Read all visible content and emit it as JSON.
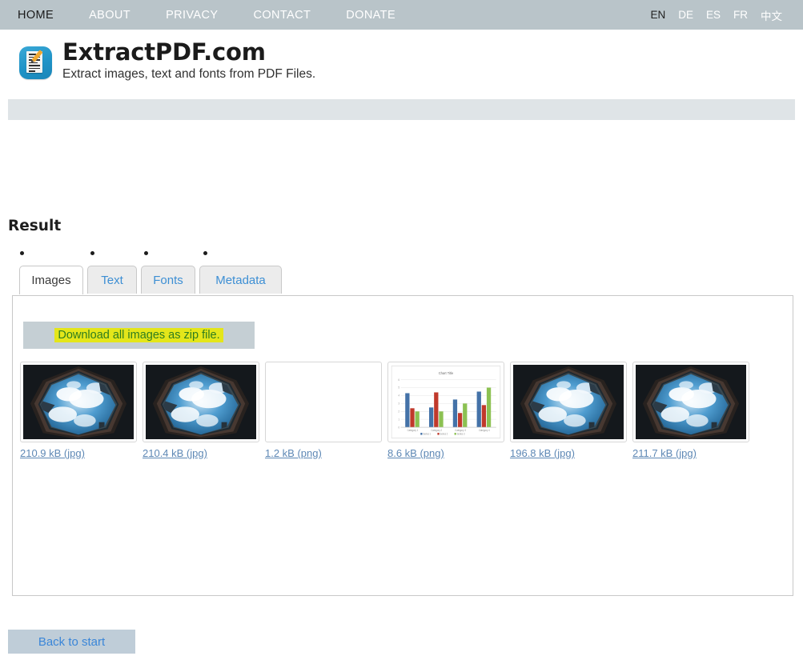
{
  "nav": {
    "items": [
      {
        "label": "HOME",
        "active": true
      },
      {
        "label": "ABOUT",
        "active": false
      },
      {
        "label": "PRIVACY",
        "active": false
      },
      {
        "label": "CONTACT",
        "active": false
      },
      {
        "label": "DONATE",
        "active": false
      }
    ],
    "languages": [
      {
        "label": "EN",
        "active": true
      },
      {
        "label": "DE",
        "active": false
      },
      {
        "label": "ES",
        "active": false
      },
      {
        "label": "FR",
        "active": false
      },
      {
        "label": "中文",
        "active": false
      }
    ]
  },
  "brand": {
    "title": "ExtractPDF.com",
    "tagline": "Extract images, text and fonts from PDF Files.",
    "logo_icon": "document-pencil-icon"
  },
  "result": {
    "heading": "Result"
  },
  "tabs": [
    {
      "label": "Images",
      "active": true
    },
    {
      "label": "Text",
      "active": false
    },
    {
      "label": "Fonts",
      "active": false
    },
    {
      "label": "Metadata",
      "active": false
    }
  ],
  "panel": {
    "download_all_label": "Download all images as zip file.",
    "thumbnails": [
      {
        "label": "210.9 kB (jpg)",
        "kind": "porthole-sky-photo"
      },
      {
        "label": "210.4 kB (jpg)",
        "kind": "porthole-sky-photo"
      },
      {
        "label": "1.2 kB (png)",
        "kind": "blank"
      },
      {
        "label": "8.6 kB (png)",
        "kind": "bar-chart"
      },
      {
        "label": "196.8 kB (jpg)",
        "kind": "porthole-sky-photo"
      },
      {
        "label": "211.7 kB (jpg)",
        "kind": "porthole-sky-photo"
      }
    ]
  },
  "footer": {
    "back_label": "Back to start"
  },
  "colors": {
    "nav_bg": "#b9c4c9",
    "ad_bar": "#dfe4e7",
    "tab_link": "#3d8fd4",
    "link": "#5e88b5",
    "highlight": "#e4e61a",
    "highlight_text": "#2e7d1f",
    "button_bg": "#c5cfd4",
    "back_button_bg": "#bfcdd8",
    "logo_blue": "#1f93c7"
  },
  "chart_data": {
    "type": "bar",
    "title": "Chart Title",
    "categories": [
      "Category 1",
      "Category 2",
      "Category 3",
      "Category 4"
    ],
    "series": [
      {
        "name": "Series 1",
        "values": [
          4.3,
          2.5,
          3.5,
          4.5
        ],
        "color": "#4472a8"
      },
      {
        "name": "Series 2",
        "values": [
          2.4,
          4.4,
          1.8,
          2.8
        ],
        "color": "#c0392b"
      },
      {
        "name": "Series 3",
        "values": [
          2.0,
          2.0,
          3.0,
          5.0
        ],
        "color": "#8cc152"
      }
    ],
    "ylim": [
      0,
      6
    ],
    "yticks": [
      0,
      1,
      2,
      3,
      4,
      5,
      6
    ],
    "xlabel": "",
    "ylabel": "",
    "grid": true,
    "legend_position": "bottom"
  }
}
